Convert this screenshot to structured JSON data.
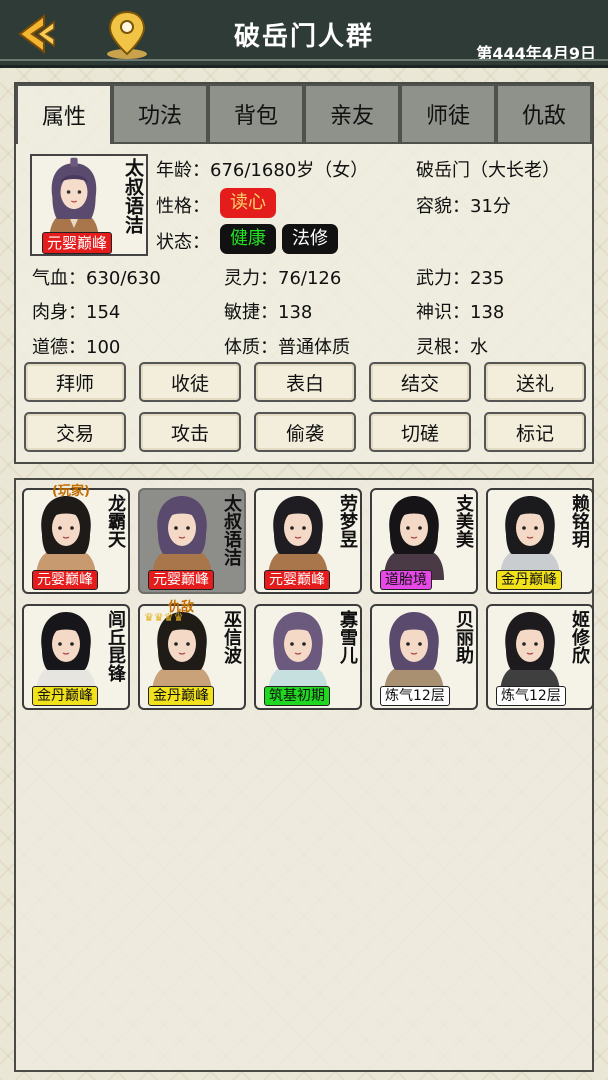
{
  "header": {
    "title": "破岳门人群",
    "date": "第444年4月9日",
    "back_icon": "back-arrow-icon",
    "location_icon": "map-pin-icon"
  },
  "tabs": [
    {
      "label": "属性",
      "active": true
    },
    {
      "label": "功法",
      "active": false
    },
    {
      "label": "背包",
      "active": false
    },
    {
      "label": "亲友",
      "active": false
    },
    {
      "label": "师徒",
      "active": false
    },
    {
      "label": "仇敌",
      "active": false
    }
  ],
  "character": {
    "name": "太叔语洁",
    "realm": "元婴巅峰",
    "age_label": "年龄：676/1680岁（女）",
    "sect_label": "破岳门（大长老）",
    "personality_key": "性格：",
    "personality_value": "读心",
    "looks_label": "容貌：31分",
    "status_key": "状态：",
    "status_values": [
      "健康",
      "法修"
    ],
    "stats": {
      "qixue": "气血：630/630",
      "lingli": "灵力：76/126",
      "wuli": "武力：235",
      "roushen": "肉身：154",
      "minjie": "敏捷：138",
      "shenshi": "神识：138",
      "daode": "道德：100",
      "tizhi": "体质：普通体质",
      "linggen": "灵根：水"
    }
  },
  "actions": [
    "拜师",
    "收徒",
    "表白",
    "结交",
    "送礼",
    "交易",
    "攻击",
    "偷袭",
    "切磋",
    "标记"
  ],
  "people": [
    {
      "name": "龙霸天",
      "realm": "元婴巅峰",
      "tag": "(玩家)",
      "realm_color": "#e51c1c",
      "realm_text": "#ffffff"
    },
    {
      "name": "太叔语洁",
      "realm": "元婴巅峰",
      "tag": "",
      "realm_color": "#e51c1c",
      "realm_text": "#ffffff",
      "selected": true
    },
    {
      "name": "劳梦昱",
      "realm": "元婴巅峰",
      "tag": "",
      "realm_color": "#e51c1c",
      "realm_text": "#ffffff"
    },
    {
      "name": "支美美",
      "realm": "道胎境",
      "tag": "",
      "realm_color": "#e649e6",
      "realm_text": "#111111"
    },
    {
      "name": "赖铭玥",
      "realm": "金丹巅峰",
      "tag": "",
      "realm_color": "#f2e21b",
      "realm_text": "#111111"
    },
    {
      "name": "闾丘昆锋",
      "realm": "金丹巅峰",
      "tag": "",
      "realm_color": "#f2e21b",
      "realm_text": "#111111"
    },
    {
      "name": "巫信波",
      "realm": "金丹巅峰",
      "tag": "仇敌",
      "realm_color": "#f2e21b",
      "realm_text": "#111111",
      "crowns": true
    },
    {
      "name": "寡雪儿",
      "realm": "筑基初期",
      "tag": "",
      "realm_color": "#1fd81f",
      "realm_text": "#111111"
    },
    {
      "name": "贝丽助",
      "realm": "炼气12层",
      "tag": "",
      "realm_color": "#ffffff",
      "realm_text": "#111111"
    },
    {
      "name": "姬修欣",
      "realm": "炼气12层",
      "tag": "",
      "realm_color": "#ffffff",
      "realm_text": "#111111"
    }
  ],
  "colors": {
    "header_bg": "#2f3b37",
    "tab_inactive": "#8f918b",
    "danger_red": "#e51c1c",
    "status_green": "#22e022",
    "badge_black": "#111111"
  }
}
